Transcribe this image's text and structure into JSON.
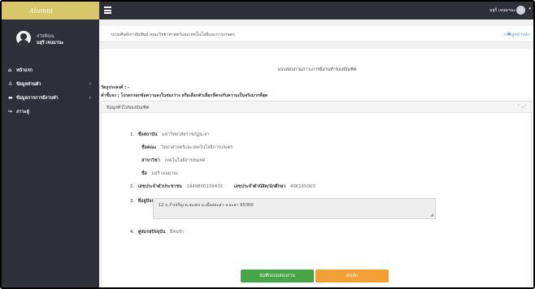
{
  "app": {
    "brand": "Alumni"
  },
  "sidebar": {
    "greeting": "สวัสดีคุณ",
    "username": "มยุรี เจนมานะ",
    "items": [
      {
        "label": "หน้าแรก",
        "icon": "home-icon",
        "has_children": false
      },
      {
        "label": "ข้อมูลส่วนตัว",
        "icon": "user-icon",
        "has_children": true
      },
      {
        "label": "ข้อมูลการการมีงานทำ",
        "icon": "briefcase-icon",
        "has_children": true
      },
      {
        "label": "ภาวะสู่",
        "icon": "signout-icon",
        "has_children": false
      }
    ]
  },
  "topbar": {
    "user": "มยุรี เจนมานะ"
  },
  "breadcrumb": {
    "title": "ระบบศิษย์เก่าสัมพันธ์ คณะวิทยาศาสตร์และเทคโนโลยีและการเกษตร",
    "home_link": "กลับสู่หน้าหลัก"
  },
  "form": {
    "heading": "แบบสอบถามภาวะการมีงานทำของบัณฑิต",
    "objective": "วัตถุประสงค์ : -",
    "instruction": "คำชี้แจง : โปรดกรอกข้อความลงในช่องว่าง หรือเลือกตัวเลือกที่ตรงกับความเป็นจริงมากที่สุด",
    "section_title": "ข้อมูลทั่วไปของบัณฑิต",
    "fields": {
      "university_num": "1.",
      "university_label": "ชื่อสถาบัน",
      "university_value": "มหาวิทยาลัยราชภัฏยะลา",
      "faculty_label": "ชื่อคณะ",
      "faculty_value": "วิทยาศาสตร์และเทคโนโลยีการเกษตร",
      "major_label": "สาขาวิชา",
      "major_value": "เทคโนโลยีสารสนเทศ",
      "name_label": "ชื่อ",
      "name_value": "มยุรี เจนมานะ",
      "id_num": "2.",
      "id_label": "เลขประจำตัวประชาชน",
      "id_value": "1949800139435",
      "student_label": "เลขประจำตัวนิสิต/นักศึกษา",
      "student_value": "406165003",
      "address_num": "3.",
      "address_label": "ที่อยู่ปัจจุบัน",
      "address_value": "12 ถ.ร่ำเจริญ  ต.สะเตง อ.เมืองยะลา จ.ยะลา 95000",
      "status_num": "4.",
      "status_label": "คู่สมรสปัจจุบัน",
      "status_value": "มีคนรัก"
    },
    "save_label": "บันทึกแบบสอบถาม",
    "cancel_label": "ยกเลิก"
  },
  "colors": {
    "sidebar_bg": "#2d3038",
    "brand_bg": "#d8c76a",
    "save_button": "#47a447",
    "cancel_button": "#f0a035",
    "link": "#5aa3d8"
  }
}
